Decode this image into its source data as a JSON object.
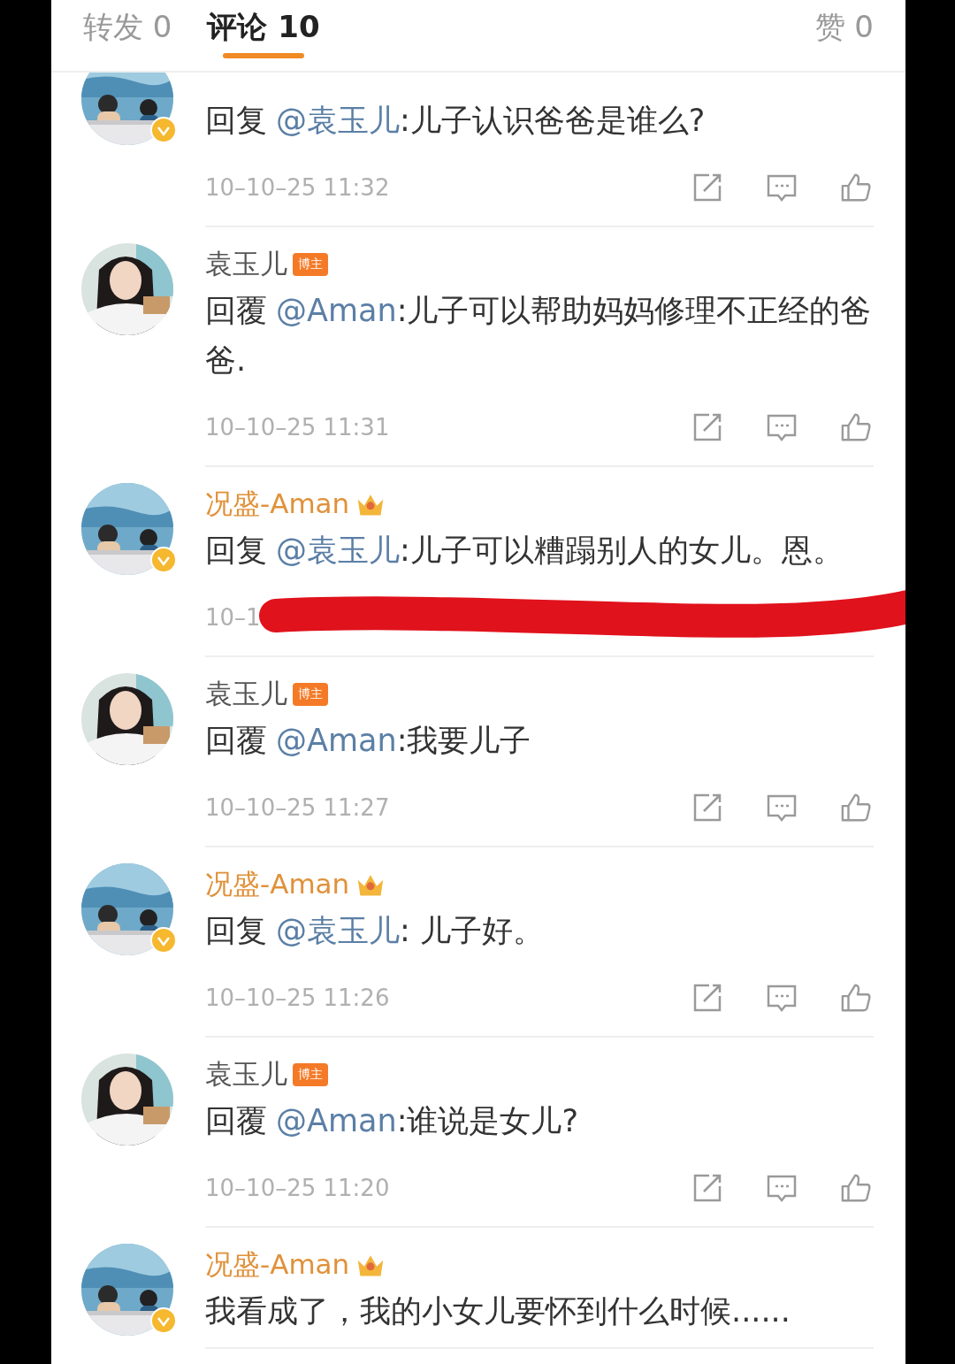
{
  "tabs": [
    {
      "label": "转发 0",
      "selected": false
    },
    {
      "label": "评论 10",
      "selected": true
    },
    {
      "label": "赞 0",
      "selected": false
    }
  ],
  "comments": [
    {
      "kind": "vip",
      "verified": true,
      "prefix": "回复",
      "mention": "@袁玉儿",
      "body": ":儿子认识爸爸是谁么?",
      "time": "10–10–25 11:32",
      "redacted": false
    },
    {
      "kind": "owner",
      "author": "袁玉儿",
      "badge": "博主",
      "verified": false,
      "prefix": "回覆",
      "mention": "@Aman",
      "body": ":儿子可以帮助妈妈修理不正经的爸爸.",
      "time": "10–10–25 11:31",
      "redacted": false
    },
    {
      "kind": "vip",
      "author": "况盛-Aman",
      "verified": true,
      "prefix": "回复",
      "mention": "@袁玉儿",
      "body": ":儿子可以糟蹋别人的女儿。恩。",
      "time": "10–1",
      "redacted": true
    },
    {
      "kind": "owner",
      "author": "袁玉儿",
      "badge": "博主",
      "verified": false,
      "prefix": "回覆",
      "mention": "@Aman",
      "body": ":我要儿子",
      "time": "10–10–25 11:27",
      "redacted": false
    },
    {
      "kind": "vip",
      "author": "况盛-Aman",
      "verified": true,
      "prefix": "回复",
      "mention": "@袁玉儿",
      "body": ": 儿子好。",
      "time": "10–10–25 11:26",
      "redacted": false
    },
    {
      "kind": "owner",
      "author": "袁玉儿",
      "badge": "博主",
      "verified": false,
      "prefix": "回覆",
      "mention": "@Aman",
      "body": ":谁说是女儿?",
      "time": "10–10–25 11:20",
      "redacted": false
    },
    {
      "kind": "vip",
      "author": "况盛-Aman",
      "verified": true,
      "body": "我看成了，我的小女儿要怀到什么时候......",
      "redacted": false
    }
  ]
}
